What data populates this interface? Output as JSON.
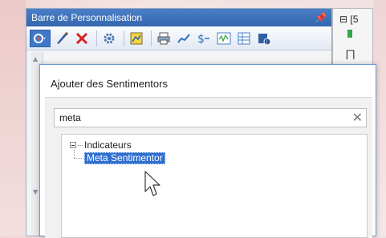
{
  "panel": {
    "title": "Barre de Personnalisation",
    "pin_glyph": "⨆",
    "toolbar_icons": [
      "dropdown-settings-icon",
      "brush-icon",
      "delete-icon",
      "gear-icon",
      "chart-template-icon",
      "print-icon",
      "trend-icon",
      "dollar-icon",
      "waveform-icon",
      "grid-icon",
      "info-icon"
    ]
  },
  "side_panel": {
    "header": "⊟ [5"
  },
  "dialog": {
    "title": "Ajouter des Sentimentors",
    "search": {
      "value": "meta",
      "clear_glyph": "✕"
    },
    "tree": {
      "root_label": "Indicateurs",
      "child_label": "Meta Sentimentor"
    }
  },
  "colors": {
    "title_bar": "#3a6fb8",
    "selection": "#2f6fd0",
    "dialog_border": "#6b9ad4"
  }
}
